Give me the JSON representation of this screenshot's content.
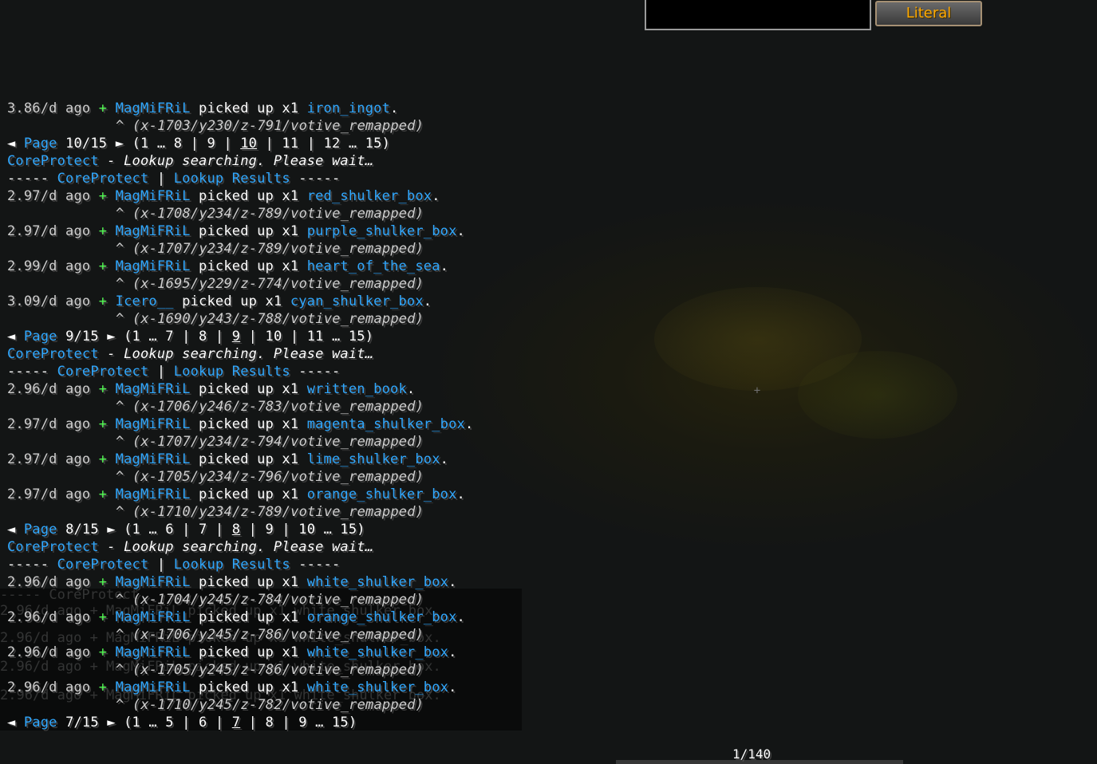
{
  "command": {
    "input_value": "",
    "suggestion": "Literal"
  },
  "chat": [
    {
      "kind": "entry",
      "time": "3.86/d ago",
      "player": "MagMiFRiL",
      "action": "picked up x1",
      "item": "iron_ingot",
      "coord": "^ (x-1703/y230/z-791/votive_remapped)"
    },
    {
      "kind": "page",
      "prev": "◄",
      "label": "Page",
      "num": "10/15",
      "next": "►",
      "nav_before": "(1 … 8 | 9 | ",
      "current": "10",
      "nav_after": " | 11 | 12 … 15)"
    },
    {
      "kind": "status",
      "brand": "CoreProtect",
      "text": " - Lookup searching. Please wait…"
    },
    {
      "kind": "header",
      "dash1": "----- ",
      "brand": "CoreProtect",
      "sep": " | ",
      "title": "Lookup Results",
      "dash2": " -----"
    },
    {
      "kind": "entry",
      "time": "2.97/d ago",
      "player": "MagMiFRiL",
      "action": "picked up x1",
      "item": "red_shulker_box",
      "coord": "^ (x-1708/y234/z-789/votive_remapped)"
    },
    {
      "kind": "entry",
      "time": "2.97/d ago",
      "player": "MagMiFRiL",
      "action": "picked up x1",
      "item": "purple_shulker_box",
      "coord": "^ (x-1707/y234/z-789/votive_remapped)"
    },
    {
      "kind": "entry",
      "time": "2.99/d ago",
      "player": "MagMiFRiL",
      "action": "picked up x1",
      "item": "heart_of_the_sea",
      "coord": "^ (x-1695/y229/z-774/votive_remapped)"
    },
    {
      "kind": "entry",
      "time": "3.09/d ago",
      "player": "Icero__",
      "action": "picked up x1",
      "item": "cyan_shulker_box",
      "coord": "^ (x-1690/y243/z-788/votive_remapped)"
    },
    {
      "kind": "page",
      "prev": "◄",
      "label": "Page",
      "num": "9/15",
      "next": "►",
      "nav_before": "(1 … 7 | 8 | ",
      "current": "9",
      "nav_after": " | 10 | 11 … 15)"
    },
    {
      "kind": "status",
      "brand": "CoreProtect",
      "text": " - Lookup searching. Please wait…"
    },
    {
      "kind": "header",
      "dash1": "----- ",
      "brand": "CoreProtect",
      "sep": " | ",
      "title": "Lookup Results",
      "dash2": " -----"
    },
    {
      "kind": "entry",
      "time": "2.96/d ago",
      "player": "MagMiFRiL",
      "action": "picked up x1",
      "item": "written_book",
      "coord": "^ (x-1706/y246/z-783/votive_remapped)"
    },
    {
      "kind": "entry",
      "time": "2.97/d ago",
      "player": "MagMiFRiL",
      "action": "picked up x1",
      "item": "magenta_shulker_box",
      "coord": "^ (x-1707/y234/z-794/votive_remapped)"
    },
    {
      "kind": "entry",
      "time": "2.97/d ago",
      "player": "MagMiFRiL",
      "action": "picked up x1",
      "item": "lime_shulker_box",
      "coord": "^ (x-1705/y234/z-796/votive_remapped)"
    },
    {
      "kind": "entry",
      "time": "2.97/d ago",
      "player": "MagMiFRiL",
      "action": "picked up x1",
      "item": "orange_shulker_box",
      "coord": "^ (x-1710/y234/z-789/votive_remapped)"
    },
    {
      "kind": "page",
      "prev": "◄",
      "label": "Page",
      "num": "8/15",
      "next": "►",
      "nav_before": "(1 … 6 | 7 | ",
      "current": "8",
      "nav_after": " | 9 | 10 … 15)"
    },
    {
      "kind": "status",
      "brand": "CoreProtect",
      "text": " - Lookup searching. Please wait…"
    },
    {
      "kind": "header",
      "dash1": "----- ",
      "brand": "CoreProtect",
      "sep": " | ",
      "title": "Lookup Results",
      "dash2": " -----"
    },
    {
      "kind": "entry",
      "time": "2.96/d ago",
      "player": "MagMiFRiL",
      "action": "picked up x1",
      "item": "white_shulker_box",
      "coord": "^ (x-1704/y245/z-784/votive_remapped)"
    },
    {
      "kind": "entry",
      "time": "2.96/d ago",
      "player": "MagMiFRiL",
      "action": "picked up x1",
      "item": "orange_shulker_box",
      "coord": "^ (x-1706/y245/z-786/votive_remapped)"
    },
    {
      "kind": "entry",
      "time": "2.96/d ago",
      "player": "MagMiFRiL",
      "action": "picked up x1",
      "item": "white_shulker_box",
      "coord": "^ (x-1705/y245/z-786/votive_remapped)"
    },
    {
      "kind": "entry",
      "time": "2.96/d ago",
      "player": "MagMiFRiL",
      "action": "picked up x1",
      "item": "white_shulker_box",
      "coord": "^ (x-1710/y245/z-782/votive_remapped)"
    },
    {
      "kind": "page",
      "prev": "◄",
      "label": "Page",
      "num": "7/15",
      "next": "►",
      "nav_before": "(1 … 5 | 6 | ",
      "current": "7",
      "nav_after": " | 8 | 9 … 15)"
    }
  ],
  "ghost_lines": [
    "----- CoreProtect",
    "2.96/d ago + MagMiFRiL picked up x1 white_shulker_box.",
    "2.96/d ago + MagMiFRiL picked up x1 white_shulker_box.",
    "2.96/d ago + MagMiFRiL picked up x1 white_shulker_box.",
    "2.96/d ago + MagMiFRiL picked up x1 white_shulker_box."
  ],
  "scroll_counter": "1/140",
  "colors": {
    "aqua": "#30a8ff",
    "green": "#55ff55",
    "gold": "#ffaa00",
    "gray": "#cfcfcf"
  }
}
